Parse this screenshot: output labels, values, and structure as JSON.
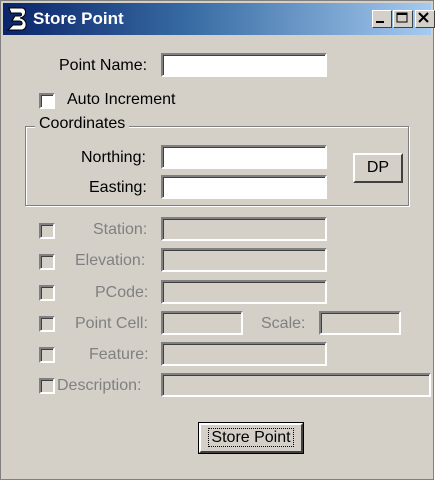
{
  "window": {
    "title": "Store Point",
    "app_icon": "bentley-b-icon"
  },
  "titlebar_buttons": {
    "minimize": "minimize-icon",
    "maximize": "maximize-icon",
    "close": "close-icon"
  },
  "fields": {
    "point_name_label": "Point Name:",
    "auto_increment_label": "Auto Increment",
    "coordinates_label": "Coordinates",
    "northing_label": "Northing:",
    "easting_label": "Easting:",
    "dp_label": "DP",
    "station_label": "Station:",
    "elevation_label": "Elevation:",
    "pcode_label": "PCode:",
    "point_cell_label": "Point Cell:",
    "scale_label": "Scale:",
    "feature_label": "Feature:",
    "description_label": "Description:"
  },
  "values": {
    "point_name": "",
    "northing": "",
    "easting": "",
    "station": "",
    "elevation": "",
    "pcode": "",
    "point_cell": "",
    "scale": "",
    "feature": "",
    "description": ""
  },
  "store_button_label": "Store Point"
}
